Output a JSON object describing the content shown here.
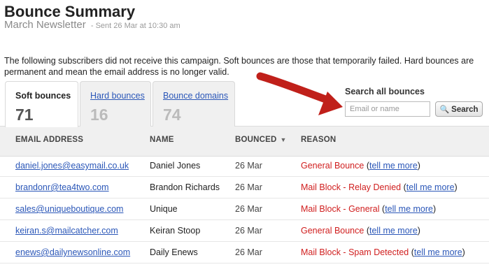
{
  "header": {
    "title": "Bounce Summary",
    "campaign": "March Newsletter",
    "sent_meta": "- Sent 26 Mar at 10:30 am"
  },
  "description": "The following subscribers did not receive this campaign. Soft bounces are those that temporarily failed. Hard bounces are permanent and mean the email address is no longer valid.",
  "tabs": [
    {
      "label": "Soft bounces",
      "count": "71"
    },
    {
      "label": "Hard bounces",
      "count": "16"
    },
    {
      "label": "Bounce domains",
      "count": "74"
    }
  ],
  "search": {
    "label": "Search all bounces",
    "placeholder": "Email or name",
    "button": "Search",
    "button_icon": "magnifier-icon"
  },
  "table": {
    "columns": [
      "EMAIL ADDRESS",
      "NAME",
      "BOUNCED",
      "REASON"
    ],
    "sort_icon": "▼",
    "more_label": "tell me more",
    "rows": [
      {
        "email": "daniel.jones@easymail.co.uk",
        "name": "Daniel Jones",
        "bounced": "26 Mar",
        "reason": "General Bounce"
      },
      {
        "email": "brandonr@tea4two.com",
        "name": "Brandon Richards",
        "bounced": "26 Mar",
        "reason": "Mail Block - Relay Denied"
      },
      {
        "email": "sales@uniqueboutique.com",
        "name": "Unique",
        "bounced": "26 Mar",
        "reason": "Mail Block - General"
      },
      {
        "email": "keiran.s@mailcatcher.com",
        "name": "Keiran Stoop",
        "bounced": "26 Mar",
        "reason": "General Bounce"
      },
      {
        "email": "enews@dailynewsonline.com",
        "name": "Daily Enews",
        "bounced": "26 Mar",
        "reason": "Mail Block - Spam Detected"
      }
    ]
  },
  "colors": {
    "link": "#2b57b8",
    "reason_red": "#d01e1e",
    "arrow_red": "#c0201a"
  }
}
